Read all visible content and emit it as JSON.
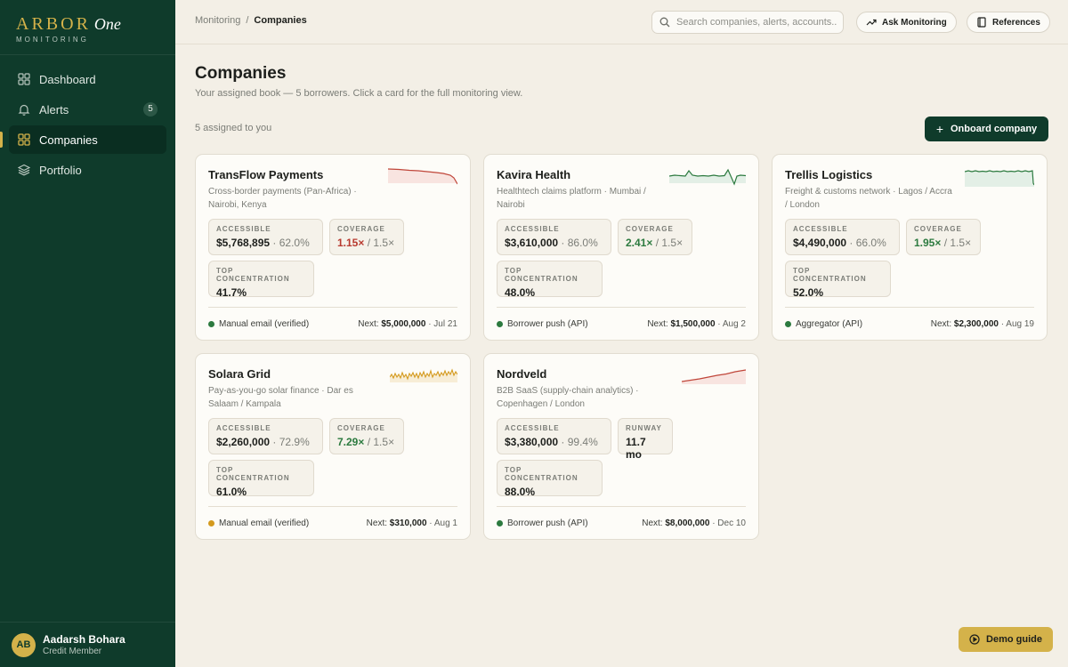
{
  "brand": {
    "name": "ARBOR",
    "suffix": "One",
    "sub": "MONITORING"
  },
  "nav": [
    {
      "label": "Dashboard",
      "icon": "dashboard-icon"
    },
    {
      "label": "Alerts",
      "icon": "bell-icon",
      "badge": "5"
    },
    {
      "label": "Companies",
      "icon": "grid-icon",
      "active": true
    },
    {
      "label": "Portfolio",
      "icon": "layers-icon"
    }
  ],
  "user": {
    "initials": "AB",
    "name": "Aadarsh Bohara",
    "role": "Credit Member"
  },
  "breadcrumb": {
    "root": "Monitoring",
    "sep": "/",
    "current": "Companies"
  },
  "search": {
    "placeholder": "Search companies, alerts, accounts..."
  },
  "topbar": {
    "ask_label": "Ask Monitoring",
    "references_label": "References"
  },
  "page": {
    "title": "Companies",
    "subtitle": "Your assigned book — 5 borrowers. Click a card for the full monitoring view.",
    "assigned": "5 assigned to you",
    "onboard_label": "Onboard company"
  },
  "metric_labels": {
    "accessible": "ACCESSIBLE",
    "coverage": "COVERAGE",
    "concentration": "TOP CONCENTRATION",
    "runway": "RUNWAY"
  },
  "next_prefix": "Next:",
  "companies": [
    {
      "name": "TransFlow Payments",
      "desc": "Cross-border payments (Pan-Africa) · Nairobi, Kenya",
      "accessible": "$5,768,895",
      "accessible_pct": "· 62.0%",
      "coverage": "1.15×",
      "coverage_target": "/ 1.5×",
      "coverage_status": "red",
      "concentration": "41.7%",
      "source": "Manual email (verified)",
      "source_color": "#2c7a3f",
      "next_amount": "$5,000,000",
      "next_date": "· Jul 21",
      "spark_color": "#c0463a",
      "spark_fill": "#f8e4e0"
    },
    {
      "name": "Kavira Health",
      "desc": "Healthtech claims platform · Mumbai / Nairobi",
      "accessible": "$3,610,000",
      "accessible_pct": "· 86.0%",
      "coverage": "2.41×",
      "coverage_target": "/ 1.5×",
      "coverage_status": "green",
      "concentration": "48.0%",
      "source": "Borrower push (API)",
      "source_color": "#2c7a3f",
      "next_amount": "$1,500,000",
      "next_date": "· Aug 2",
      "spark_color": "#2c7a3f",
      "spark_fill": "#e3efe6"
    },
    {
      "name": "Trellis Logistics",
      "desc": "Freight & customs network · Lagos / Accra / London",
      "accessible": "$4,490,000",
      "accessible_pct": "· 66.0%",
      "coverage": "1.95×",
      "coverage_target": "/ 1.5×",
      "coverage_status": "green",
      "concentration": "52.0%",
      "source": "Aggregator (API)",
      "source_color": "#2c7a3f",
      "next_amount": "$2,300,000",
      "next_date": "· Aug 19",
      "spark_color": "#2c7a3f",
      "spark_fill": "#e3efe6"
    },
    {
      "name": "Solara Grid",
      "desc": "Pay-as-you-go solar finance · Dar es Salaam / Kampala",
      "accessible": "$2,260,000",
      "accessible_pct": "· 72.9%",
      "coverage": "7.29×",
      "coverage_target": "/ 1.5×",
      "coverage_status": "green",
      "concentration": "61.0%",
      "source": "Manual email (verified)",
      "source_color": "#d49a1e",
      "next_amount": "$310,000",
      "next_date": "· Aug 1",
      "spark_color": "#d49a1e",
      "spark_fill": "#f7edd6"
    },
    {
      "name": "Nordveld",
      "desc": "B2B SaaS (supply-chain analytics) · Copenhagen / London",
      "accessible": "$3,380,000",
      "accessible_pct": "· 99.4%",
      "runway": "11.7 mo",
      "concentration": "88.0%",
      "source": "Borrower push (API)",
      "source_color": "#2c7a3f",
      "next_amount": "$8,000,000",
      "next_date": "· Dec 10",
      "spark_color": "#c0463a",
      "spark_fill": "#f8e4e0"
    }
  ],
  "demo_label": "Demo guide"
}
